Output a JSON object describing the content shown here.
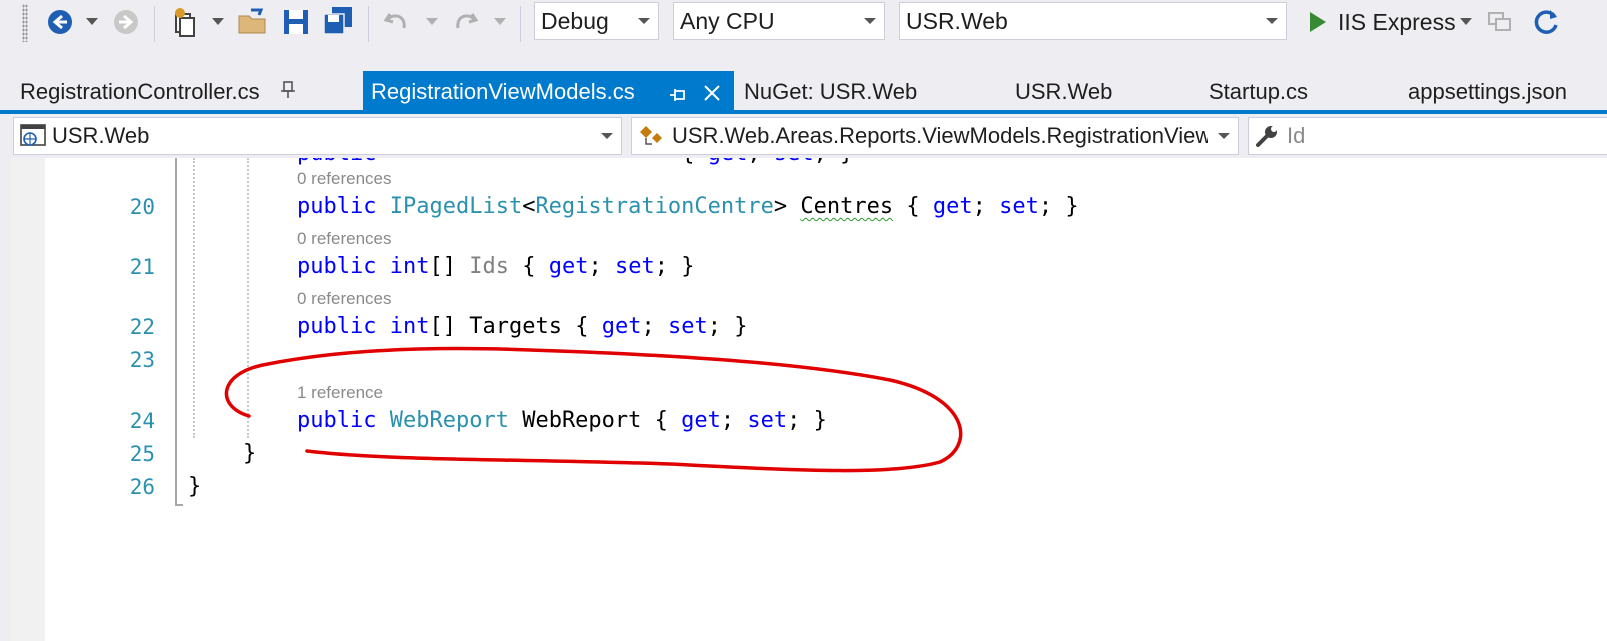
{
  "toolbar": {
    "config": "Debug",
    "platform": "Any CPU",
    "startup_project": "USR.Web",
    "run_target": "IIS Express",
    "icons": [
      "back-icon",
      "forward-icon",
      "new-project-icon",
      "open-folder-icon",
      "save-icon",
      "save-all-icon",
      "undo-icon",
      "redo-icon",
      "start-icon",
      "browser-link-icon",
      "refresh-icon"
    ]
  },
  "tabs": [
    {
      "label": "RegistrationController.cs"
    },
    {
      "label": "RegistrationViewModels.cs"
    },
    {
      "label": "NuGet: USR.Web"
    },
    {
      "label": "USR.Web"
    },
    {
      "label": "Startup.cs"
    },
    {
      "label": "appsettings.json"
    }
  ],
  "navbar": {
    "project": "USR.Web",
    "type": "USR.Web.Areas.Reports.ViewModels.RegistrationView",
    "member": "Id"
  },
  "editor": {
    "lines": [
      {
        "num": "20",
        "lens": "0 references",
        "kw": "public",
        "type": "IPagedList",
        "lt": "<",
        "generic": "RegistrationCentre",
        "gt": ">",
        "name": "Centres",
        "accessors": "{ get; set; }"
      },
      {
        "num": "21",
        "lens": "0 references",
        "kw": "public",
        "type": "int",
        "suffix": "[]",
        "name": "Ids",
        "accessors": "{ get; set; }"
      },
      {
        "num": "22",
        "lens": "0 references",
        "kw": "public",
        "type": "int",
        "suffix": "[]",
        "name": "Targets",
        "accessors": "{ get; set; }"
      },
      {
        "num": "23"
      },
      {
        "num": "24",
        "lens": "1 reference",
        "kw": "public",
        "type": "WebReport",
        "name": "WebReport",
        "accessors": "{ get; set; }"
      },
      {
        "num": "25",
        "text": "}"
      },
      {
        "num": "26",
        "text": "}"
      }
    ],
    "keywords": {
      "get": "get",
      "set": "set"
    }
  },
  "colors": {
    "accent": "#007acc",
    "keyword": "#0000ff",
    "type": "#2b91af",
    "annotation": "#e00000"
  }
}
